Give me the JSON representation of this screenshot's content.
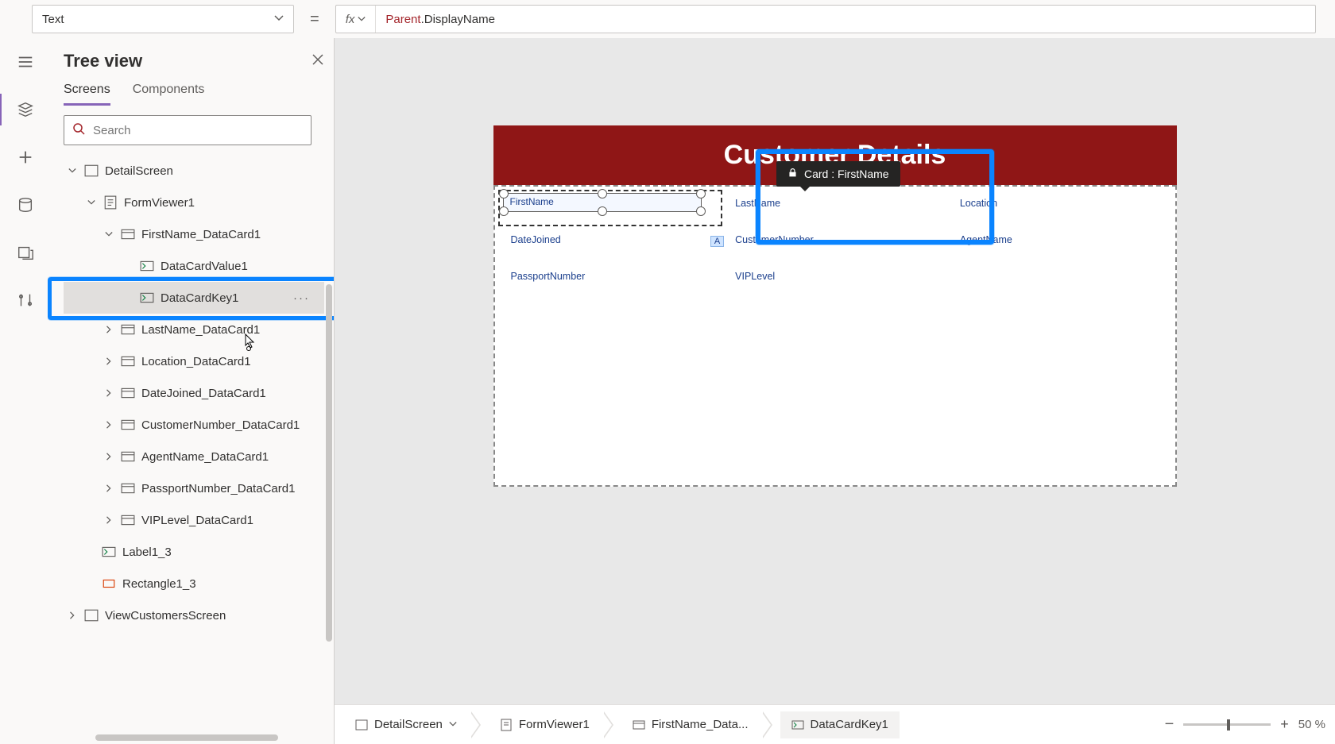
{
  "property_selector": {
    "value": "Text"
  },
  "formula": {
    "parent": "Parent",
    "member": "DisplayName"
  },
  "tree": {
    "title": "Tree view",
    "tabs": {
      "screens": "Screens",
      "components": "Components"
    },
    "search_placeholder": "Search",
    "items": {
      "detail_screen": "DetailScreen",
      "form_viewer": "FormViewer1",
      "firstname_card": "FirstName_DataCard1",
      "datacard_value": "DataCardValue1",
      "datacard_key": "DataCardKey1",
      "lastname_card": "LastName_DataCard1",
      "location_card": "Location_DataCard1",
      "datejoined_card": "DateJoined_DataCard1",
      "customernumber_card": "CustomerNumber_DataCard1",
      "agentname_card": "AgentName_DataCard1",
      "passport_card": "PassportNumber_DataCard1",
      "viplevel_card": "VIPLevel_DataCard1",
      "label": "Label1_3",
      "rectangle": "Rectangle1_3",
      "view_customers": "ViewCustomersScreen"
    }
  },
  "canvas": {
    "header_title": "Customer Details",
    "tooltip": "Card : FirstName",
    "a_badge": "A",
    "fields": {
      "firstname": "FirstName",
      "lastname": "LastName",
      "location": "Location",
      "datejoined": "DateJoined",
      "customernumber": "CustomerNumber",
      "agentname": "AgentName",
      "passportnumber": "PassportNumber",
      "viplevel": "VIPLevel"
    }
  },
  "breadcrumb": {
    "screen": "DetailScreen",
    "form": "FormViewer1",
    "card": "FirstName_Data...",
    "key": "DataCardKey1"
  },
  "zoom": {
    "minus": "−",
    "plus": "+",
    "pct": "50",
    "pct_suffix": "%"
  }
}
